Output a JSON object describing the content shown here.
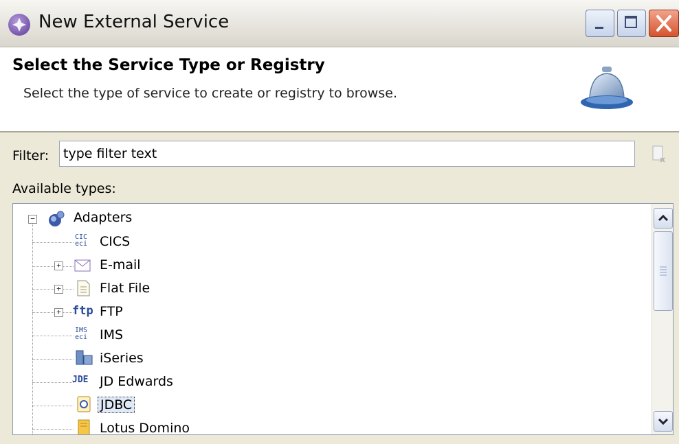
{
  "window": {
    "title": "New External Service",
    "icon": "wizard-icon"
  },
  "banner": {
    "title": "Select the Service Type or Registry",
    "subtitle": "Select the type of service to create or registry to browse.",
    "icon": "service-bell-icon"
  },
  "filter": {
    "label": "Filter:",
    "value": "type filter text",
    "clear_icon": "clear-filter-icon"
  },
  "types": {
    "label": "Available types:",
    "items": [
      {
        "label": "Adapters",
        "icon": "adapters-icon",
        "expander": "−"
      },
      {
        "label": "CICS",
        "icon": "cics-eci-icon",
        "icon_text": "CIC\neci"
      },
      {
        "label": "E-mail",
        "icon": "envelope-icon",
        "expander": "+"
      },
      {
        "label": "Flat File",
        "icon": "file-icon",
        "expander": "+"
      },
      {
        "label": "FTP",
        "icon": "ftp-icon",
        "icon_text": "ftp",
        "expander": "+"
      },
      {
        "label": "IMS",
        "icon": "ims-eci-icon",
        "icon_text": "IMS\neci"
      },
      {
        "label": "iSeries",
        "icon": "iseries-icon"
      },
      {
        "label": "JD Edwards",
        "icon": "jde-icon",
        "icon_text": "JDE"
      },
      {
        "label": "JDBC",
        "icon": "jdbc-icon",
        "selected": true
      },
      {
        "label": "Lotus Domino",
        "icon": "lotus-domino-icon"
      }
    ]
  },
  "colors": {
    "selection": "#dfe9f8",
    "title_gradient_top": "#f7f6f2",
    "close_button": "#d4532e"
  }
}
